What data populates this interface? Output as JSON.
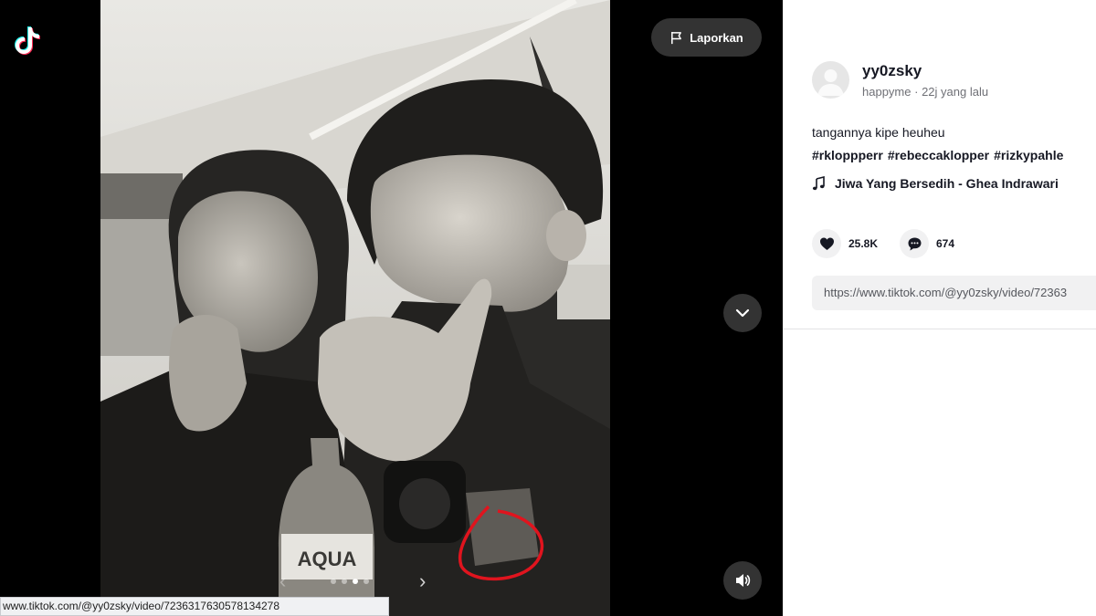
{
  "app": {
    "logo_icon": "tiktok-logo-icon"
  },
  "player": {
    "report_label": "Laporkan",
    "report_icon": "flag-icon",
    "next_video_icon": "chevron-down-icon",
    "sound_icon": "speaker-icon",
    "prev_icon": "chevron-left-icon",
    "next_icon": "chevron-right-icon",
    "prev_glyph": "‹",
    "next_glyph": "›",
    "slide_count": 4,
    "active_slide": 2,
    "photo": {
      "description": "black and white selfie",
      "bottle_brand": "AQUA",
      "annotation_color": "#e0141e"
    }
  },
  "status_bar": {
    "url": "www.tiktok.com/@yy0zsky/video/7236317630578134278"
  },
  "post": {
    "username": "yy0zsky",
    "nickname": "happyme",
    "separator": "·",
    "time": "22j yang lalu",
    "caption": "tangannya kipe heuheu",
    "hashtags": [
      "#rkloppperr",
      "#rebeccaklopper",
      "#rizkypahle"
    ],
    "music": {
      "icon": "music-note-icon",
      "title": "Jiwa Yang Bersedih - Ghea Indrawari"
    },
    "likes": {
      "icon": "heart-icon",
      "count": "25.8K"
    },
    "comments": {
      "icon": "comment-icon",
      "count": "674"
    },
    "link": "https://www.tiktok.com/@yy0zsky/video/72363"
  },
  "colors": {
    "player_bg": "#000000",
    "panel_bg": "#ffffff",
    "button_bg": "#3c3c3c",
    "text": "#161823",
    "muted": "#6f7076"
  }
}
